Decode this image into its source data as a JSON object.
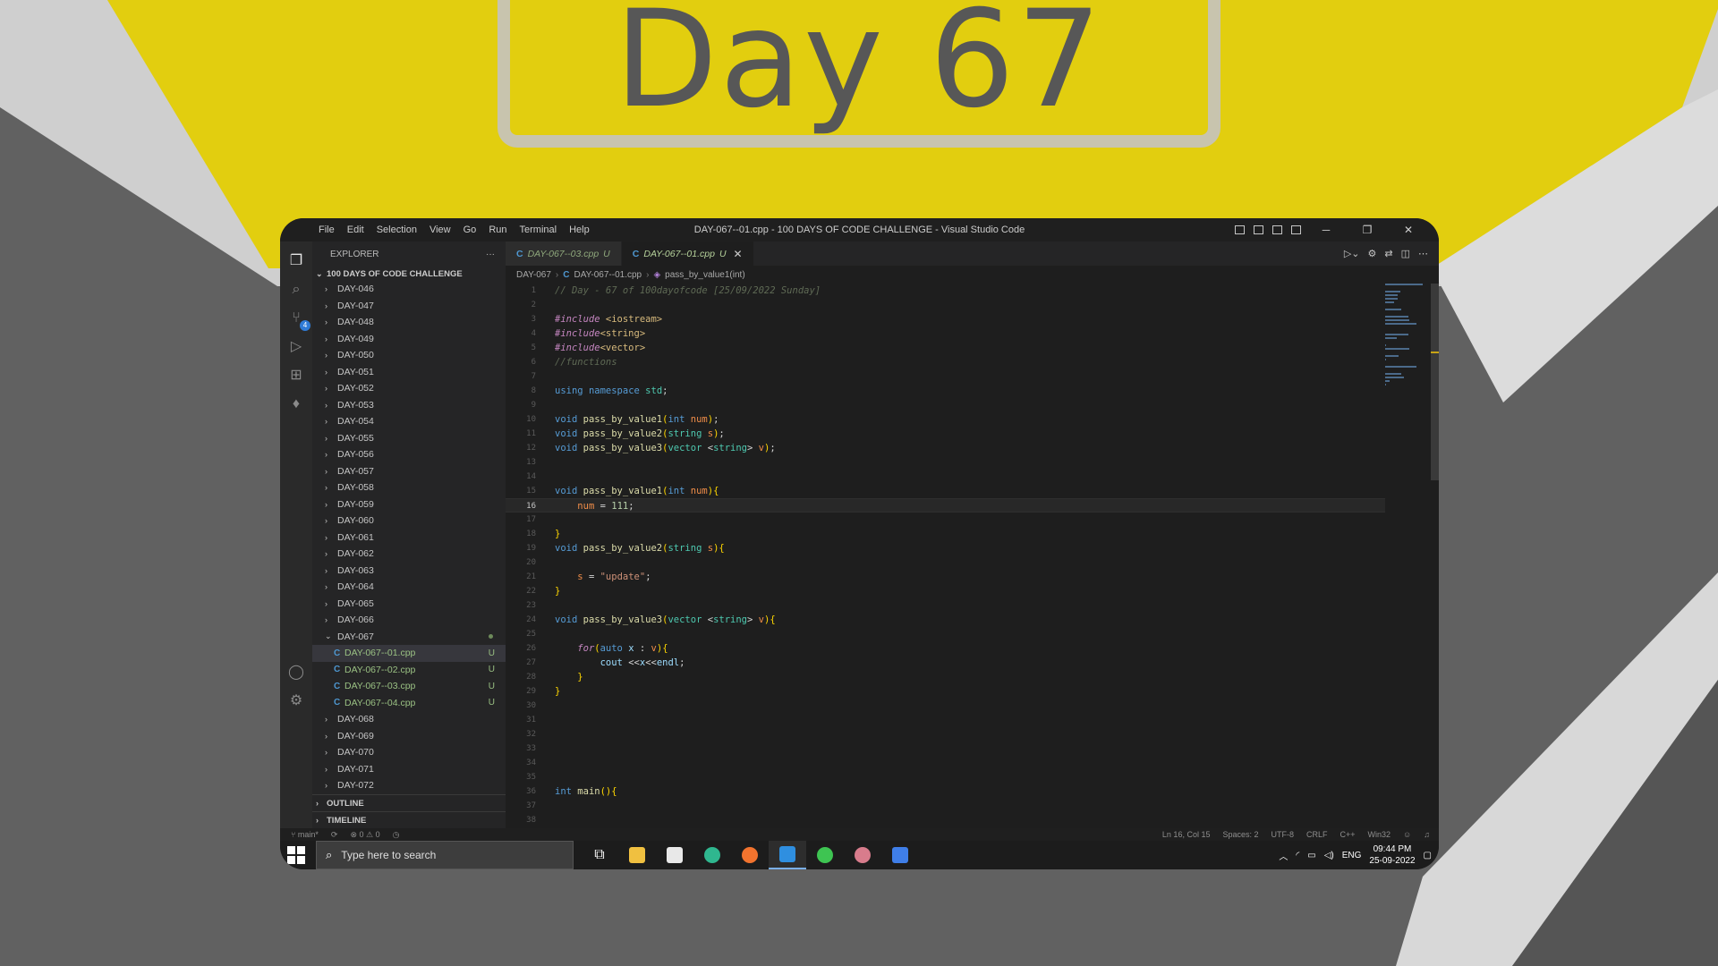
{
  "overlay": {
    "title": "Day 67"
  },
  "window": {
    "title": "DAY-067--01.cpp - 100 DAYS OF CODE CHALLENGE - Visual Studio Code",
    "menu": [
      "File",
      "Edit",
      "Selection",
      "View",
      "Go",
      "Run",
      "Terminal",
      "Help"
    ],
    "controls": {
      "minimize": "─",
      "restore": "❐",
      "close": "✕"
    }
  },
  "activity_bar": {
    "scm_badge": "4"
  },
  "sidebar": {
    "header": "EXPLORER",
    "header_more": "···",
    "root": "100 DAYS OF CODE CHALLENGE",
    "folders_before": [
      "DAY-046",
      "DAY-047",
      "DAY-048",
      "DAY-049",
      "DAY-050",
      "DAY-051",
      "DAY-052",
      "DAY-053",
      "DAY-054",
      "DAY-055",
      "DAY-056",
      "DAY-057",
      "DAY-058",
      "DAY-059",
      "DAY-060",
      "DAY-061",
      "DAY-062",
      "DAY-063",
      "DAY-064",
      "DAY-065",
      "DAY-066"
    ],
    "open_folder": "DAY-067",
    "files": [
      {
        "name": "DAY-067--01.cpp",
        "status": "U"
      },
      {
        "name": "DAY-067--02.cpp",
        "status": "U"
      },
      {
        "name": "DAY-067--03.cpp",
        "status": "U"
      },
      {
        "name": "DAY-067--04.cpp",
        "status": "U"
      }
    ],
    "folders_after": [
      "DAY-068",
      "DAY-069",
      "DAY-070",
      "DAY-071",
      "DAY-072"
    ],
    "outline": "OUTLINE",
    "timeline": "TIMELINE"
  },
  "tabs": [
    {
      "name": "DAY-067--03.cpp",
      "status": "U"
    },
    {
      "name": "DAY-067--01.cpp",
      "status": "U",
      "close": "✕"
    }
  ],
  "breadcrumb": {
    "folder": "DAY-067",
    "file": "DAY-067--01.cpp",
    "symbol": "pass_by_value1(int)"
  },
  "current_line": 16,
  "status_bar": {
    "branch": "main*",
    "errors": "⊗ 0 ⚠ 0",
    "position": "Ln 16, Col 15",
    "spaces": "Spaces: 2",
    "encoding": "UTF-8",
    "eol": "CRLF",
    "language": "C++",
    "platform": "Win32"
  },
  "taskbar": {
    "search_placeholder": "Type here to search",
    "lang": "ENG",
    "time": "09:44 PM",
    "date": "25-09-2022"
  },
  "code": [
    "// Day - 67 of 100dayofcode [25/09/2022 Sunday]",
    "",
    "#include <iostream>",
    "#include<string>",
    "#include<vector>",
    "//functions",
    "",
    "using namespace std;",
    "",
    "void pass_by_value1(int num);",
    "void pass_by_value2(string s);",
    "void pass_by_value3(vector <string> v);",
    "",
    "",
    "void pass_by_value1(int num){",
    "    num = 111;",
    "",
    "}",
    "void pass_by_value2(string s){",
    "",
    "    s = \"update\";",
    "}",
    "",
    "void pass_by_value3(vector <string> v){",
    "",
    "    for(auto x : v){",
    "        cout <<x<<endl;",
    "    }",
    "}",
    "",
    "",
    "",
    "",
    "",
    "",
    "int main(){",
    "",
    ""
  ]
}
